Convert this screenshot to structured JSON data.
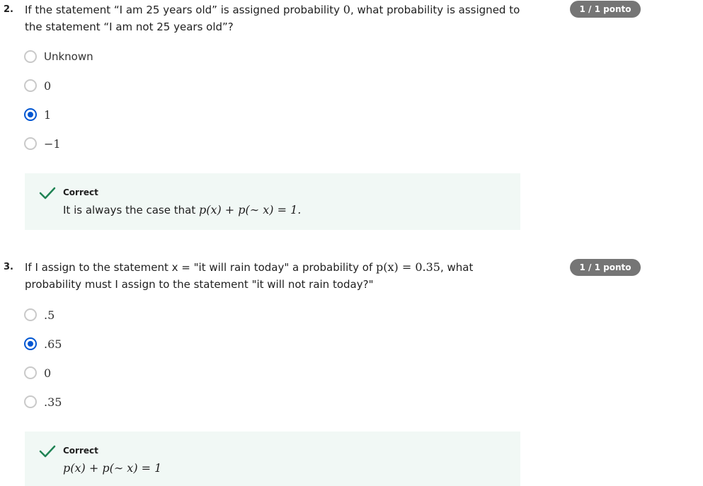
{
  "questions": [
    {
      "number": "2.",
      "text_part1": "If the statement “I am 25 years old” is assigned probability ",
      "text_math": "0",
      "text_part2": ", what probability is assigned to the statement “I am not 25 years old”?",
      "points": "1 / 1 ponto",
      "options": [
        {
          "label": "Unknown",
          "selected": false
        },
        {
          "label": "0",
          "selected": false
        },
        {
          "label": "1",
          "selected": true
        },
        {
          "label": "−1",
          "selected": false
        }
      ],
      "feedback": {
        "status": "Correct",
        "text_prefix": "It is always the case that ",
        "formula": "p(x) + p(∼ x) = 1."
      }
    },
    {
      "number": "3.",
      "text_part1": "If I assign to the statement x = \"it will rain today\" a probability of ",
      "text_math": "p(x) = 0.35",
      "text_part2": ", what probability must I assign to the statement \"it will not rain today?\"",
      "points": "1 / 1 ponto",
      "options": [
        {
          "label": ".5",
          "selected": false
        },
        {
          "label": ".65",
          "selected": true
        },
        {
          "label": "0",
          "selected": false
        },
        {
          "label": ".35",
          "selected": false
        }
      ],
      "feedback": {
        "status": "Correct",
        "text_prefix": "",
        "formula": "p(x) + p(∼ x) = 1"
      }
    }
  ],
  "colors": {
    "accent": "#0056d2",
    "correct": "#1f8354",
    "feedback_bg": "#f1f8f5",
    "badge_bg": "#757575"
  }
}
